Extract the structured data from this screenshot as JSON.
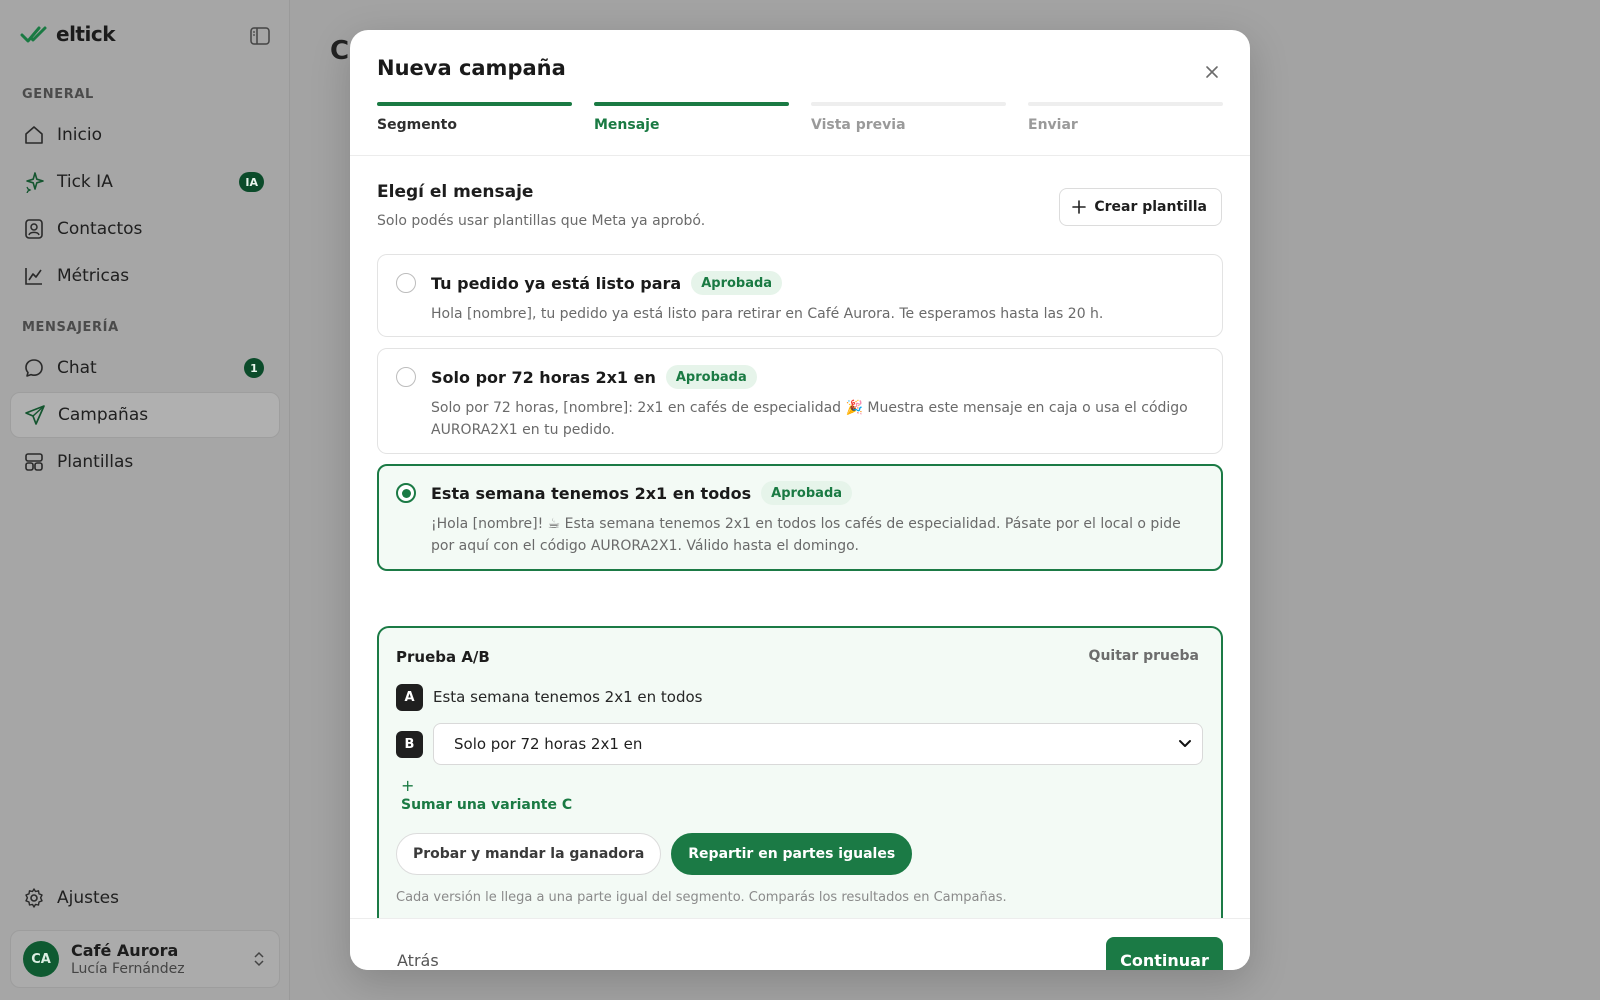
{
  "app": {
    "logo_text": "eltick",
    "background_title": "C"
  },
  "sidebar": {
    "general_label": "GENERAL",
    "messaging_label": "MENSAJERÍA",
    "items": [
      {
        "label": "Inicio",
        "icon": "home-icon"
      },
      {
        "label": "Tick IA",
        "icon": "sparkle-icon",
        "badge": "IA"
      },
      {
        "label": "Contactos",
        "icon": "contacts-icon"
      },
      {
        "label": "Métricas",
        "icon": "chart-icon"
      },
      {
        "label": "Chat",
        "icon": "chat-icon",
        "badge": "1"
      },
      {
        "label": "Campañas",
        "icon": "send-icon",
        "active": true
      },
      {
        "label": "Plantillas",
        "icon": "templates-icon"
      }
    ],
    "settings_label": "Ajustes",
    "account": {
      "initials": "CA",
      "name": "Café Aurora",
      "user": "Lucía Fernández"
    }
  },
  "modal": {
    "title": "Nueva campaña",
    "steps": [
      {
        "label": "Segmento",
        "state": "done"
      },
      {
        "label": "Mensaje",
        "state": "current"
      },
      {
        "label": "Vista previa",
        "state": "pending"
      },
      {
        "label": "Enviar",
        "state": "pending"
      }
    ],
    "section_title": "Elegí el mensaje",
    "section_subtitle": "Solo podés usar plantillas que Meta ya aprobó.",
    "create_template_label": "Crear plantilla",
    "templates": [
      {
        "name": "Tu pedido ya está listo para",
        "status": "Aprobada",
        "body": "Hola [nombre], tu pedido ya está listo para retirar en Café Aurora. Te esperamos hasta las 20 h.",
        "selected": false
      },
      {
        "name": "Solo por 72 horas 2x1 en",
        "status": "Aprobada",
        "body": "Solo por 72 horas, [nombre]: 2x1 en cafés de especialidad 🎉 Muestra este mensaje en caja o usa el código AURORA2X1 en tu pedido.",
        "selected": false
      },
      {
        "name": "Esta semana tenemos 2x1 en todos",
        "status": "Aprobada",
        "body": "¡Hola [nombre]! ☕ Esta semana tenemos 2x1 en todos los cafés de especialidad. Pásate por el local o pide por aquí con el código AURORA2X1. Válido hasta el domingo.",
        "selected": true
      }
    ],
    "ab_test": {
      "title": "Prueba A/B",
      "remove_label": "Quitar prueba",
      "variant_a_tag": "A",
      "variant_a_text": "Esta semana tenemos 2x1 en todos",
      "variant_b_tag": "B",
      "variant_b_selected": "Solo por 72 horas 2x1 en",
      "add_variant_plus": "+",
      "add_variant_label": "Sumar una variante C",
      "mode_winner_label": "Probar y mandar la ganadora",
      "mode_equal_label": "Repartir en partes iguales",
      "mode_selected": "equal",
      "note": "Cada versión le llega a una parte igual del segmento. Comparás los resultados en Campañas."
    },
    "footer": {
      "back_label": "Atrás",
      "continue_label": "Continuar"
    }
  },
  "colors": {
    "accent": "#1b7a45",
    "badge_dark": "#0b4b2a",
    "approved_bg": "#e6f4ea"
  }
}
